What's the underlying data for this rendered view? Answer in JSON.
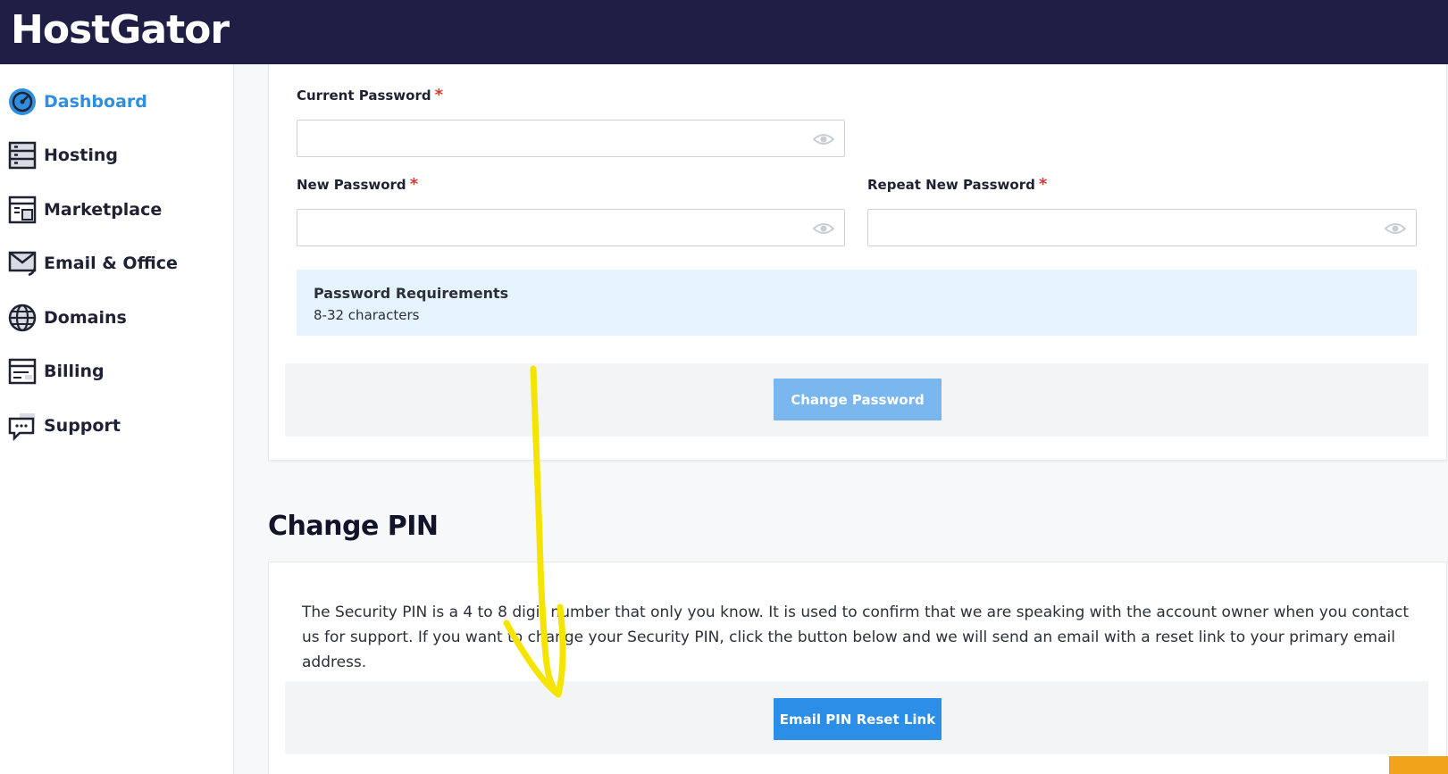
{
  "brand": {
    "logo_text": "HostGator"
  },
  "colors": {
    "header_bg": "#1f1f45",
    "accent": "#2f8fdf",
    "required": "#e0342f",
    "annotation": "#f5e400",
    "corner_badge": "#f0a31b"
  },
  "sidebar": {
    "items": [
      {
        "label": "Dashboard",
        "icon": "dashboard-gauge-icon",
        "active": true
      },
      {
        "label": "Hosting",
        "icon": "hosting-server-icon"
      },
      {
        "label": "Marketplace",
        "icon": "marketplace-layout-icon"
      },
      {
        "label": "Email & Office",
        "icon": "email-envelope-icon"
      },
      {
        "label": "Domains",
        "icon": "globe-icon"
      },
      {
        "label": "Billing",
        "icon": "billing-card-icon"
      },
      {
        "label": "Support",
        "icon": "support-chat-icon"
      }
    ]
  },
  "change_password": {
    "current_password": {
      "label": "Current Password",
      "required_mark": "*",
      "value": ""
    },
    "new_password": {
      "label": "New Password",
      "required_mark": "*",
      "value": ""
    },
    "repeat_password": {
      "label": "Repeat New Password",
      "required_mark": "*",
      "value": ""
    },
    "requirements": {
      "title": "Password Requirements",
      "text": "8-32 characters"
    },
    "submit_label": "Change Password"
  },
  "change_pin": {
    "title": "Change PIN",
    "description": "The Security PIN is a 4 to 8 digit number that only you know. It is used to confirm that we are speaking with the account owner when you contact us for support. If you want to change your Security PIN, click the button below and we will send an email with a reset link to your primary email address.",
    "button_label": "Email PIN Reset Link"
  }
}
